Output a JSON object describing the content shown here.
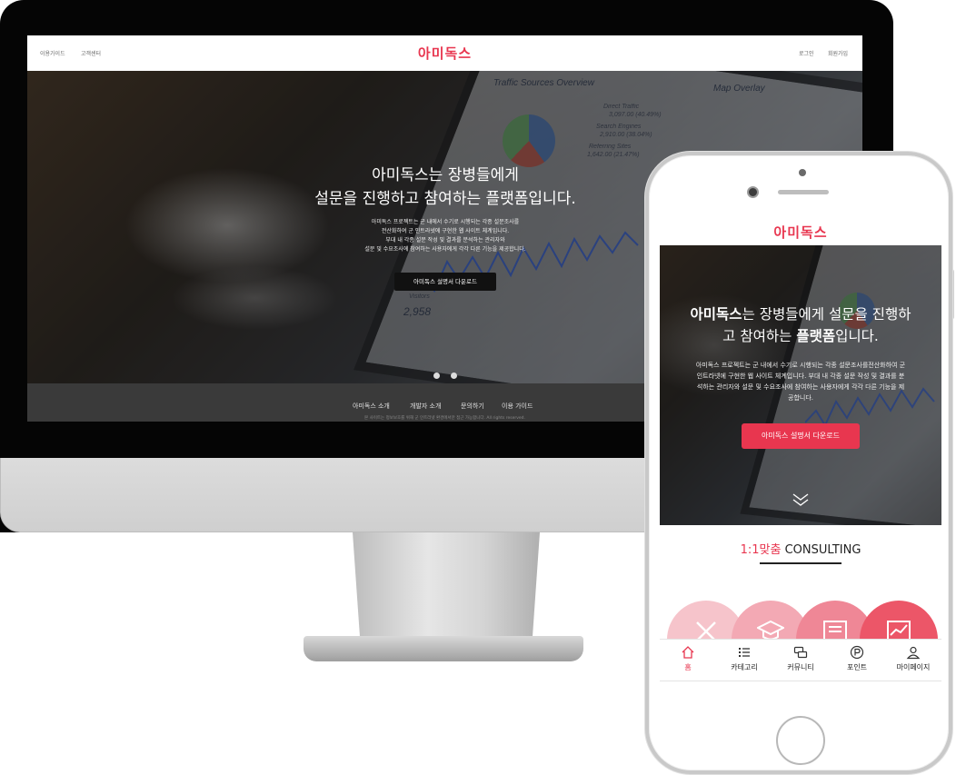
{
  "desktop": {
    "topbar": {
      "left_links": [
        "이용가이드",
        "고객센터"
      ],
      "logo": "아미독스",
      "right_links": [
        "로그인",
        "회원가입"
      ]
    },
    "hero": {
      "title_line1": "아미독스는 장병들에게",
      "title_line2": "설문을 진행하고 참여하는 플랫폼입니다.",
      "desc_lines": [
        "아미독스 프로젝트는 군 내에서 수기로 시행되는 각종 설문조사를",
        "전산화하여 군 인트라넷에 구현한 웹 사이트 체계입니다.",
        "부대 내 각종 설문 작성 및 결과를 분석하는 관리자와",
        "설문 및 수요조사에 참여하는 사용자에게 각각 다른 기능을 제공합니다."
      ],
      "download_button": "아미독스 설명서 다운로드",
      "background_text": {
        "traffic_title": "Traffic Sources Overview",
        "map_title": "Map Overlay",
        "direct": "Direct Traffic",
        "direct_val": "3,097.00 (40.49%)",
        "search": "Search Engines",
        "search_val": "2,910.00 (38.04%)",
        "referring": "Referring Sites",
        "referring_val": "1,642.00 (21.47%)",
        "visitors": "Visitors",
        "visitors_val": "2,958"
      },
      "slide_count": 2
    },
    "footer": {
      "nav": [
        "아미독스 소개",
        "개발자 소개",
        "문의하기",
        "이용 가이드"
      ],
      "sub": "본 사이트는 정보보호를 위해 군 인트라넷 환경에서만 접근 가능합니다. All rights reserved."
    }
  },
  "mobile": {
    "logo": "아미독스",
    "hero": {
      "title_bold": "아미독스",
      "title_line1_rest": "는 장병들에게 설문을 진행하",
      "title_line2_pre": "고 참여하는 ",
      "title_line2_bold": "플랫폼",
      "title_line2_post": "입니다.",
      "desc_lines": [
        "아미독스 프로젝트는 군 내에서 수기로 시행되는 각종 설문조사를전산화하여 군",
        "인트라넷에 구현한 웹 사이트 체계입니다. 부대 내 각종 설문 작성 및 결과를 분",
        "석하는 관리자와 설문 및 수요조사에 참여하는 사용자에게 각각 다른 기능을 제",
        "공합니다."
      ],
      "download_button": "아미독스 설명서 다운로드"
    },
    "consulting": {
      "highlight": "1:1맞춤",
      "rest": "CONSULTING"
    },
    "tabs": [
      {
        "label": "홈",
        "icon": "home-icon",
        "active": true
      },
      {
        "label": "카테고리",
        "icon": "list-icon",
        "active": false
      },
      {
        "label": "커뮤니티",
        "icon": "chat-icon",
        "active": false
      },
      {
        "label": "포인트",
        "icon": "point-icon",
        "active": false
      },
      {
        "label": "마이페이지",
        "icon": "user-icon",
        "active": false
      }
    ],
    "category_icons": [
      "tools-icon",
      "graduation-cap-icon",
      "newspaper-icon",
      "chart-icon"
    ]
  },
  "colors": {
    "brand_red": "#e8364f",
    "button_dark": "#111111",
    "footer_gray": "#3a3a3a"
  }
}
